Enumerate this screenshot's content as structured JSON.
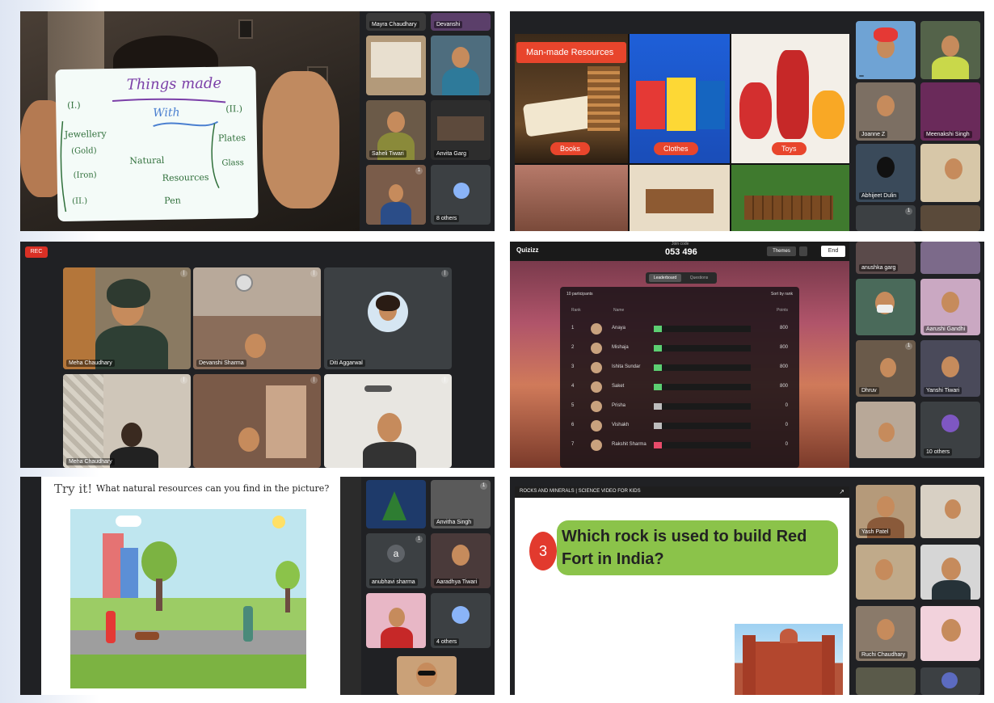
{
  "panel1": {
    "whiteboard": {
      "title": "Things made",
      "subtitle": "With"
    },
    "participants": [
      {
        "name": "Mayra Chaudhary"
      },
      {
        "name": "Devanshi"
      },
      {
        "name": "Saheli Tiwari"
      },
      {
        "name": ""
      },
      {
        "name": "Anvita Garg"
      },
      {
        "name": ""
      },
      {
        "name": "8 others"
      }
    ]
  },
  "panel2": {
    "banner": "Man-made Resources",
    "labels": [
      "Books",
      "Clothes",
      "Toys"
    ],
    "participants": [
      {
        "name": ""
      },
      {
        "name": ""
      },
      {
        "name": "Joanne Z"
      },
      {
        "name": "Meenakshi Singh"
      },
      {
        "name": "Abhijeet Dulin"
      },
      {
        "name": ""
      },
      {
        "name": ""
      },
      {
        "name": ""
      }
    ]
  },
  "panel3": {
    "rec_badge": "REC",
    "participants": [
      {
        "name": "Meha Chaudhary"
      },
      {
        "name": "Devanshi Sharma"
      },
      {
        "name": "Diti Aggarwal"
      },
      {
        "name": "Meha Chaudhary"
      },
      {
        "name": ""
      },
      {
        "name": ""
      }
    ]
  },
  "panel4": {
    "brand": "Quizizz",
    "join_code_label": "Join code",
    "join_code": "053 496",
    "top_buttons": [
      "Themes",
      "End"
    ],
    "tabs": [
      "Leaderboard",
      "Questions"
    ],
    "participants_label": "10 participants",
    "sort_label": "Sort by rank",
    "headers": [
      "Rank",
      "Name",
      "Points"
    ],
    "rows": [
      {
        "rank": "1",
        "name": "Anaya",
        "score": "800",
        "color": "#5ccf72"
      },
      {
        "rank": "2",
        "name": "Mishaja",
        "score": "800",
        "color": "#5ccf72"
      },
      {
        "rank": "3",
        "name": "Ishita Sundar",
        "score": "800",
        "color": "#5ccf72"
      },
      {
        "rank": "4",
        "name": "Saket",
        "score": "800",
        "color": "#5ccf72"
      },
      {
        "rank": "5",
        "name": "Prisha",
        "score": "0",
        "color": "#bdbdbd"
      },
      {
        "rank": "6",
        "name": "Vishakh",
        "score": "0",
        "color": "#bdbdbd"
      },
      {
        "rank": "7",
        "name": "Rakshit Sharma",
        "score": "0",
        "color": "#e84b6a"
      }
    ],
    "participants": [
      {
        "name": "anushka garg"
      },
      {
        "name": ""
      },
      {
        "name": ""
      },
      {
        "name": "Aarushi Gandhi"
      },
      {
        "name": "Dhruv"
      },
      {
        "name": "Yanshi Tiwari"
      },
      {
        "name": ""
      },
      {
        "name": "10 others"
      }
    ]
  },
  "panel5": {
    "heading_try": "Try it!",
    "heading_question": "What natural resources can you find in the picture?",
    "participants": [
      {
        "name": ""
      },
      {
        "name": "Anvitha Singh"
      },
      {
        "name": "anubhavi sharma"
      },
      {
        "name": "Aaradhya Tiwari"
      },
      {
        "name": ""
      },
      {
        "name": "4 others"
      },
      {
        "name": ""
      }
    ]
  },
  "panel6": {
    "video_title": "ROCKS AND MINERALS | SCIENCE VIDEO FOR KIDS",
    "question_number": "3",
    "question": "Which rock is used to build Red Fort in India?",
    "participants": [
      {
        "name": "Yash Patel"
      },
      {
        "name": ""
      },
      {
        "name": ""
      },
      {
        "name": ""
      },
      {
        "name": "Ruchi Chaudhary"
      },
      {
        "name": ""
      },
      {
        "name": ""
      },
      {
        "name": ""
      }
    ]
  },
  "colors": {
    "meet_bg": "#202124",
    "tile_bg": "#3c4043",
    "accent_red": "#e8452c",
    "answer_green": "#8bc34a"
  }
}
